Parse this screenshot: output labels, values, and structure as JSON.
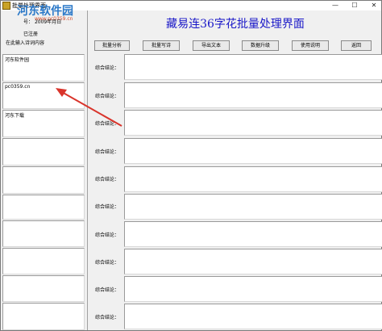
{
  "window": {
    "title": "批量处理界面",
    "controls": {
      "minimize": "—",
      "maximize": "☐",
      "close": "✕"
    }
  },
  "watermark": {
    "text": "河东软件园",
    "url": "www.pc0359.cn"
  },
  "left": {
    "serial_label": "号：",
    "serial_value": "2009年月日",
    "registered": "已注册",
    "prompt": "在此输入诗词内容",
    "boxes": [
      {
        "text": "河东软件园"
      },
      {
        "text": "pc0359.cn"
      },
      {
        "text": "河东下载"
      },
      {
        "text": ""
      },
      {
        "text": ""
      },
      {
        "text": ""
      },
      {
        "text": ""
      },
      {
        "text": ""
      },
      {
        "text": ""
      }
    ]
  },
  "main": {
    "title": "藏易连36字花批量处理界面"
  },
  "toolbar": {
    "batch_analysis": "批量分析",
    "batch_write": "批量写诗",
    "export_text": "导出文本",
    "data_upgrade": "数据升级",
    "usage": "使用说明",
    "back": "返回"
  },
  "results": {
    "label": "综合结论：",
    "rows": [
      {
        "value": ""
      },
      {
        "value": ""
      },
      {
        "value": ""
      },
      {
        "value": ""
      },
      {
        "value": ""
      },
      {
        "value": ""
      },
      {
        "value": ""
      },
      {
        "value": ""
      },
      {
        "value": ""
      },
      {
        "value": ""
      }
    ]
  },
  "colors": {
    "title_blue": "#1a18c8",
    "annotation_arrow": "#d9342b",
    "watermark_blue": "#2a78c8"
  }
}
